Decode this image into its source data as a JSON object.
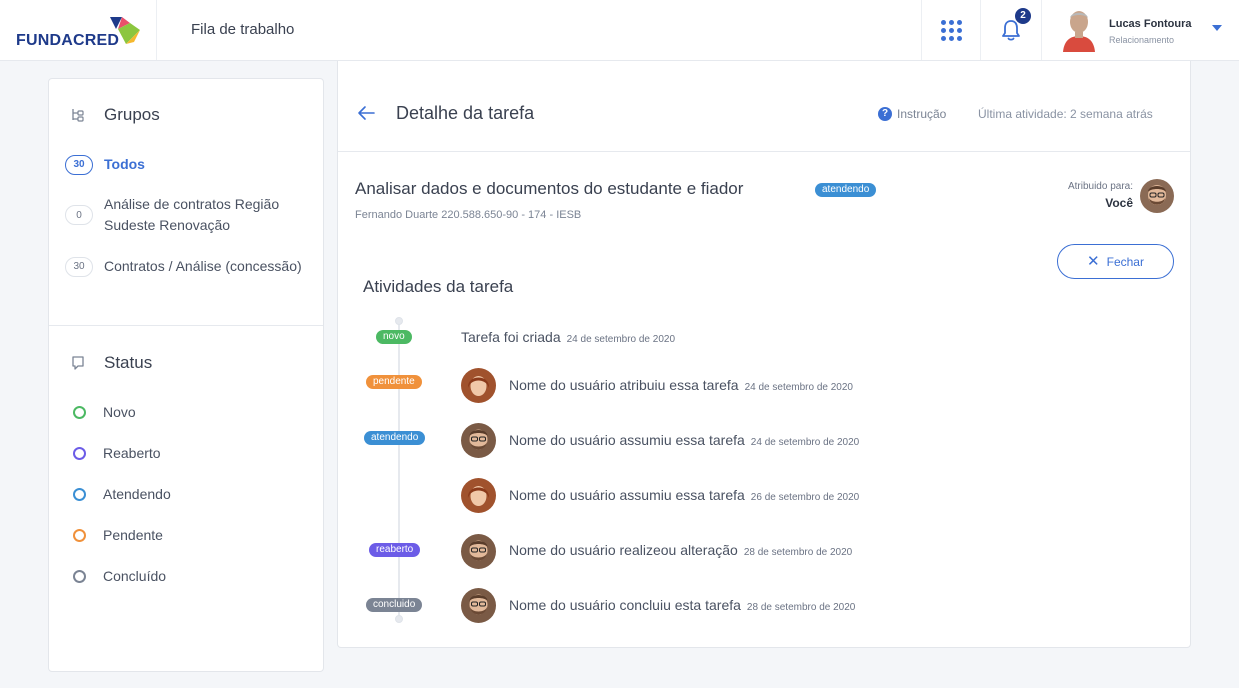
{
  "brand": {
    "name": "FUNDACRED",
    "color": "#1e3a8a"
  },
  "header": {
    "section_title": "Fila de trabalho",
    "notification_count": "2",
    "user": {
      "name": "Lucas Fontoura",
      "role": "Relacionamento"
    }
  },
  "sidebar": {
    "groups_title": "Grupos",
    "groups": [
      {
        "count": "30",
        "label": "Todos",
        "active": true
      },
      {
        "count": "0",
        "label": "Análise de contratos Região Sudeste Renovação",
        "active": false
      },
      {
        "count": "30",
        "label": "Contratos / Análise (concessão)",
        "active": false
      }
    ],
    "status_title": "Status",
    "statuses": [
      {
        "label": "Novo",
        "color": "#4cb963"
      },
      {
        "label": "Reaberto",
        "color": "#6c5ce7"
      },
      {
        "label": "Atendendo",
        "color": "#3b8fd4"
      },
      {
        "label": "Pendente",
        "color": "#f0913b"
      },
      {
        "label": "Concluído",
        "color": "#7b8494"
      }
    ]
  },
  "detail": {
    "title": "Detalhe da tarefa",
    "instruction_label": "Instrução",
    "last_activity": "Última atividade: 2 semana atrás",
    "task": {
      "title": "Analisar dados e documentos do estudante e fiador",
      "status": "atendendo",
      "subtitle": "Fernando Duarte 220.588.650-90 - 174 - IESB",
      "assigned_label": "Atribuido para:",
      "assigned_to": "Você"
    },
    "close_label": "Fechar",
    "activities_title": "Atividades da tarefa",
    "activities": [
      {
        "tag": "novo",
        "tag_color": "#4cb963",
        "text": "Tarefa foi criada",
        "date": "24 de setembro de 2020",
        "avatar": "none"
      },
      {
        "tag": "pendente",
        "tag_color": "#f0913b",
        "text": "Nome do usuário atribuiu essa tarefa",
        "date": "24 de setembro de 2020",
        "avatar": "woman"
      },
      {
        "tag": "atendendo",
        "tag_color": "#3b8fd4",
        "text": "Nome do usuário assumiu essa tarefa",
        "date": "24 de setembro de 2020",
        "avatar": "man"
      },
      {
        "tag": "",
        "tag_color": "",
        "text": "Nome do usuário assumiu essa tarefa",
        "date": "26 de setembro de 2020",
        "avatar": "woman"
      },
      {
        "tag": "reaberto",
        "tag_color": "#6c5ce7",
        "text": "Nome do usuário realizeou alteração",
        "date": "28 de setembro de 2020",
        "avatar": "man"
      },
      {
        "tag": "concluido",
        "tag_color": "#7b8494",
        "text": "Nome do usuário concluiu esta tarefa",
        "date": "28 de setembro de 2020",
        "avatar": "man"
      }
    ]
  },
  "colors": {
    "accent": "#3b6fd4",
    "atendendo": "#3b8fd4"
  }
}
